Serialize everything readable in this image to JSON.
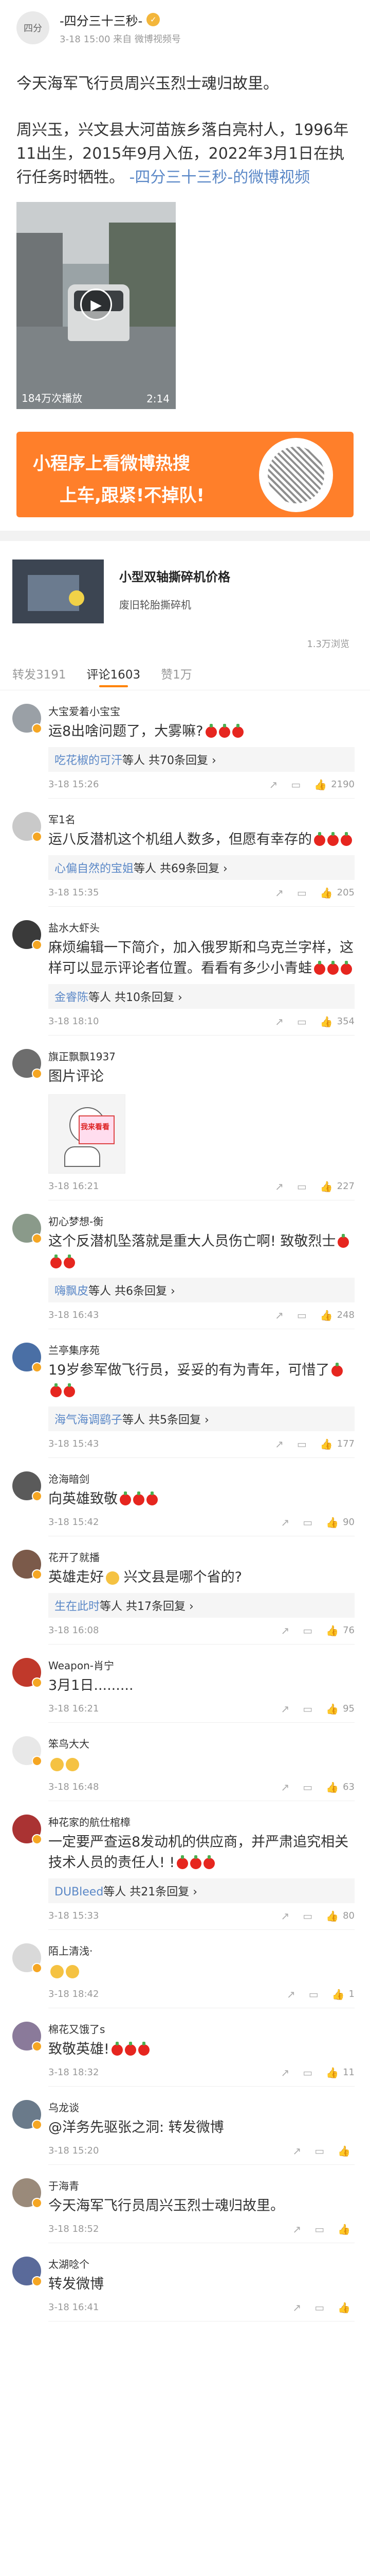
{
  "post": {
    "author": "-四分三十三秒-",
    "time": "3-18 15:00 来自 微博视频号",
    "para1": "今天海军飞行员周兴玉烈士魂归故里。",
    "para2": "周兴玉，兴文县大河苗族乡落白亮村人，1996年11出生，2015年9月入伍，2022年3月1日在执行任务时牺牲。",
    "para2_link": "-四分三十三秒-的微博视频",
    "video": {
      "views": "184万次播放",
      "duration": "2:14"
    }
  },
  "banner": {
    "line1": "小程序上看微博热搜",
    "line2": "上车,跟紧!不掉队!"
  },
  "ad": {
    "title": "小型双轴撕碎机价格",
    "subtitle": "废旧轮胎撕碎机",
    "views": "1.3万浏览"
  },
  "tabs": {
    "repost": "转发3191",
    "comment": "评论1603",
    "like": "赞1万"
  },
  "comments": [
    {
      "name": "大宝爱着小宝宝",
      "text": "运8出啥问题了，大雾嘛?",
      "reply_user": "吃花椒的可汗",
      "reply_rest": "等人 共70条回复",
      "time": "3-18 15:26",
      "likes": "2190",
      "av": "#9aa0a6"
    },
    {
      "name": "军1名",
      "text": "运八反潜机这个机组人数多，但愿有幸存的",
      "reply_user": "心偏自然的宝姐",
      "reply_rest": "等人 共69条回复",
      "time": "3-18 15:35",
      "likes": "205",
      "av": "#c9c9c9"
    },
    {
      "name": "盐水大虾头",
      "text": "麻烦编辑一下简介，加入俄罗斯和乌克兰字样，这样可以显示评论者位置。看看有多少小青蛙",
      "reply_user": "金睿陈",
      "reply_rest": "等人 共10条回复",
      "time": "3-18 18:10",
      "likes": "354",
      "av": "#3a3a3a"
    },
    {
      "name": "旗正飘飘1937",
      "text": "图片评论",
      "pic_text": "我来看看",
      "time": "3-18 16:21",
      "likes": "227",
      "av": "#6d6d6d"
    },
    {
      "name": "初心梦想-衡",
      "text": "这个反潜机坠落就是重大人员伤亡啊! 致敬烈士",
      "reply_user": "嗨飘皮",
      "reply_rest": "等人 共6条回复",
      "time": "3-18 16:43",
      "likes": "248",
      "av": "#8a9a8a"
    },
    {
      "name": "兰亭集序苑",
      "text": "19岁参军做飞行员，妥妥的有为青年，可惜了",
      "reply_user": "海气海调鹞子",
      "reply_rest": "等人 共5条回复",
      "time": "3-18 15:43",
      "likes": "177",
      "av": "#4a6fa5"
    },
    {
      "name": "沧海暗剑",
      "text": "向英雄致敬",
      "time": "3-18 15:42",
      "likes": "90",
      "av": "#5a5a5a"
    },
    {
      "name": "花开了就播",
      "text": "英雄走好",
      "text2": "兴文县是哪个省的?",
      "reply_user": "生在此时",
      "reply_rest": "等人 共17条回复",
      "time": "3-18 16:08",
      "likes": "76",
      "av": "#7b5a4a"
    },
    {
      "name": "Weapon-肖宁",
      "text": "3月1日.........",
      "time": "3-18 16:21",
      "likes": "95",
      "av": "#c0392b"
    },
    {
      "name": "笨鸟大大",
      "time": "3-18 16:48",
      "likes": "63",
      "av": "#e8e8e8"
    },
    {
      "name": "种花家的航仕棺樟",
      "text": "一定要严查运8发动机的供应商，并严肃追究相关技术人员的责任人! !",
      "reply_user": "DUBleed",
      "reply_rest": "等人 共21条回复",
      "time": "3-18 15:33",
      "likes": "80",
      "av": "#a33"
    },
    {
      "name": "陌上清浅·",
      "time": "3-18 18:42",
      "likes": "1",
      "av": "#d9d9d9"
    },
    {
      "name": "棉花又饿了s",
      "text": "致敬英雄!",
      "time": "3-18 18:32",
      "likes": "11",
      "av": "#8a7a9a"
    },
    {
      "name": "乌龙谈",
      "text": "@洋务先驱张之洞: 转发微博",
      "time": "3-18 15:20",
      "likes": "",
      "av": "#6a7a8a"
    },
    {
      "name": "于海青",
      "text": "今天海军飞行员周兴玉烈士魂归故里。",
      "time": "3-18 18:52",
      "likes": "",
      "av": "#9a8a7a"
    },
    {
      "name": "太湖唸个",
      "text": "转发微博",
      "time": "3-18 16:41",
      "likes": "",
      "av": "#5a6a9a"
    }
  ]
}
